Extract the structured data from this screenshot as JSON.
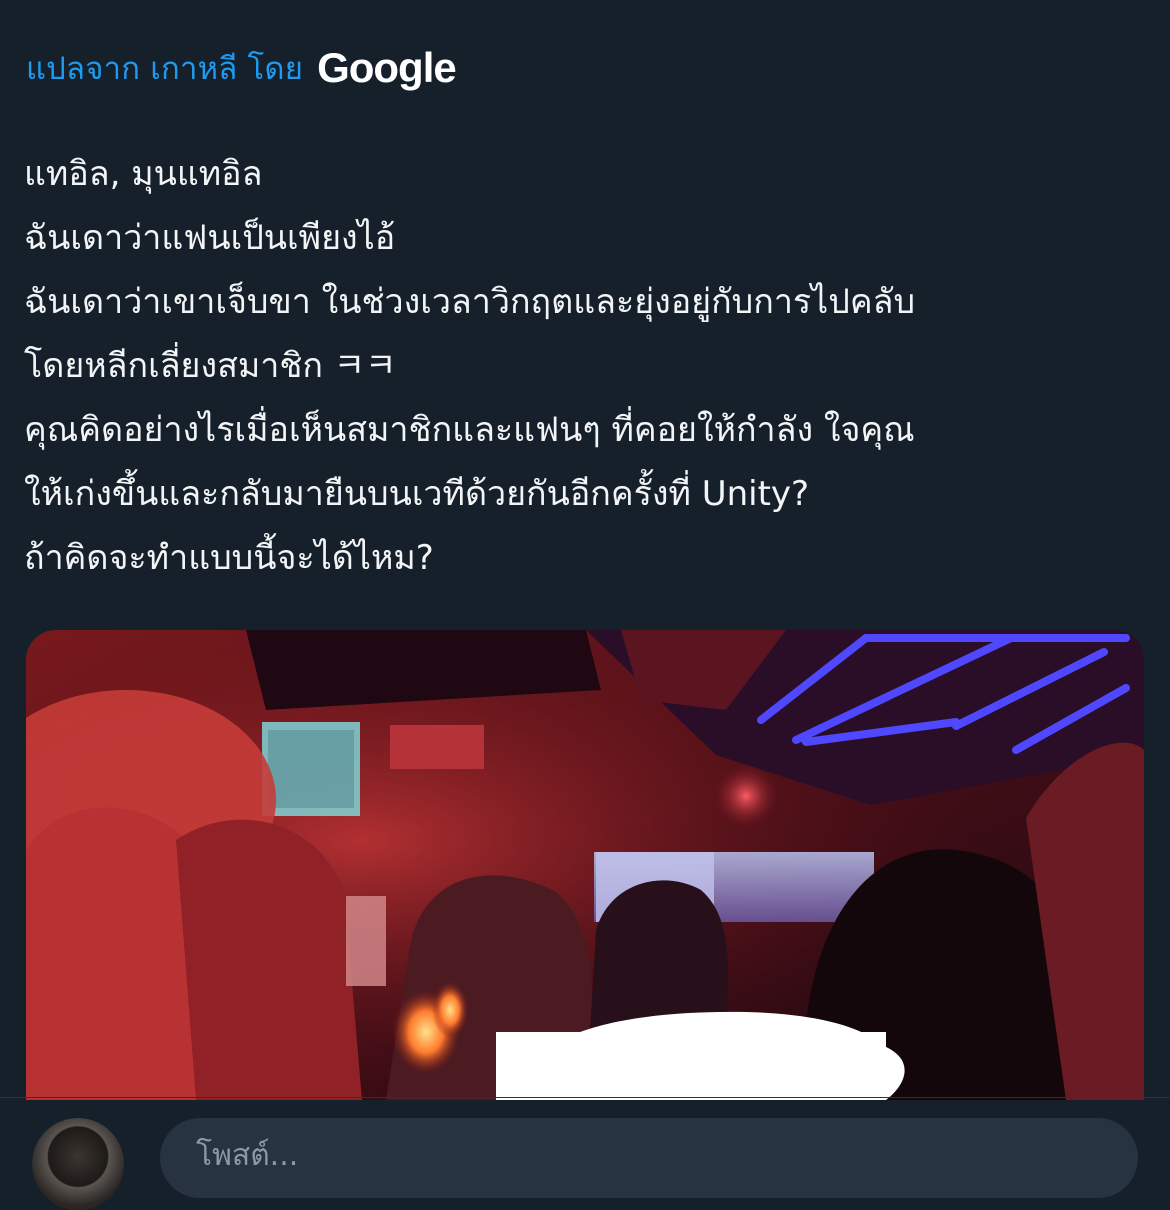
{
  "translation": {
    "label": "แปลจาก เกาหลี โดย",
    "provider": "Google"
  },
  "tweet": {
    "lines": [
      "แทอิล, มุนแทอิล",
      "ฉันเดาว่าแฟนเป็นเพียงไอ้",
      "ฉันเดาว่าเขาเจ็บขา ในช่วงเวลาวิกฤตและยุ่งอยู่กับการไปคลับ",
      "โดยหลีกเลี่ยงสมาชิก ㅋㅋ",
      "คุณคิดอย่างไรเมื่อเห็นสมาชิกและแฟนๆ ที่คอยให้กำลัง ใจคุณ",
      "ให้เก่งขึ้นและกลับมายืนบนเวทีด้วยกันอีกครั้งที่ Unity?",
      "ถ้าคิดจะทำแบบนี้จะได้ไหม?"
    ]
  },
  "reply": {
    "placeholder": "โพสต์..."
  },
  "colors": {
    "background": "#15202b",
    "link": "#1d9bf0",
    "text": "#f2f4f5"
  }
}
